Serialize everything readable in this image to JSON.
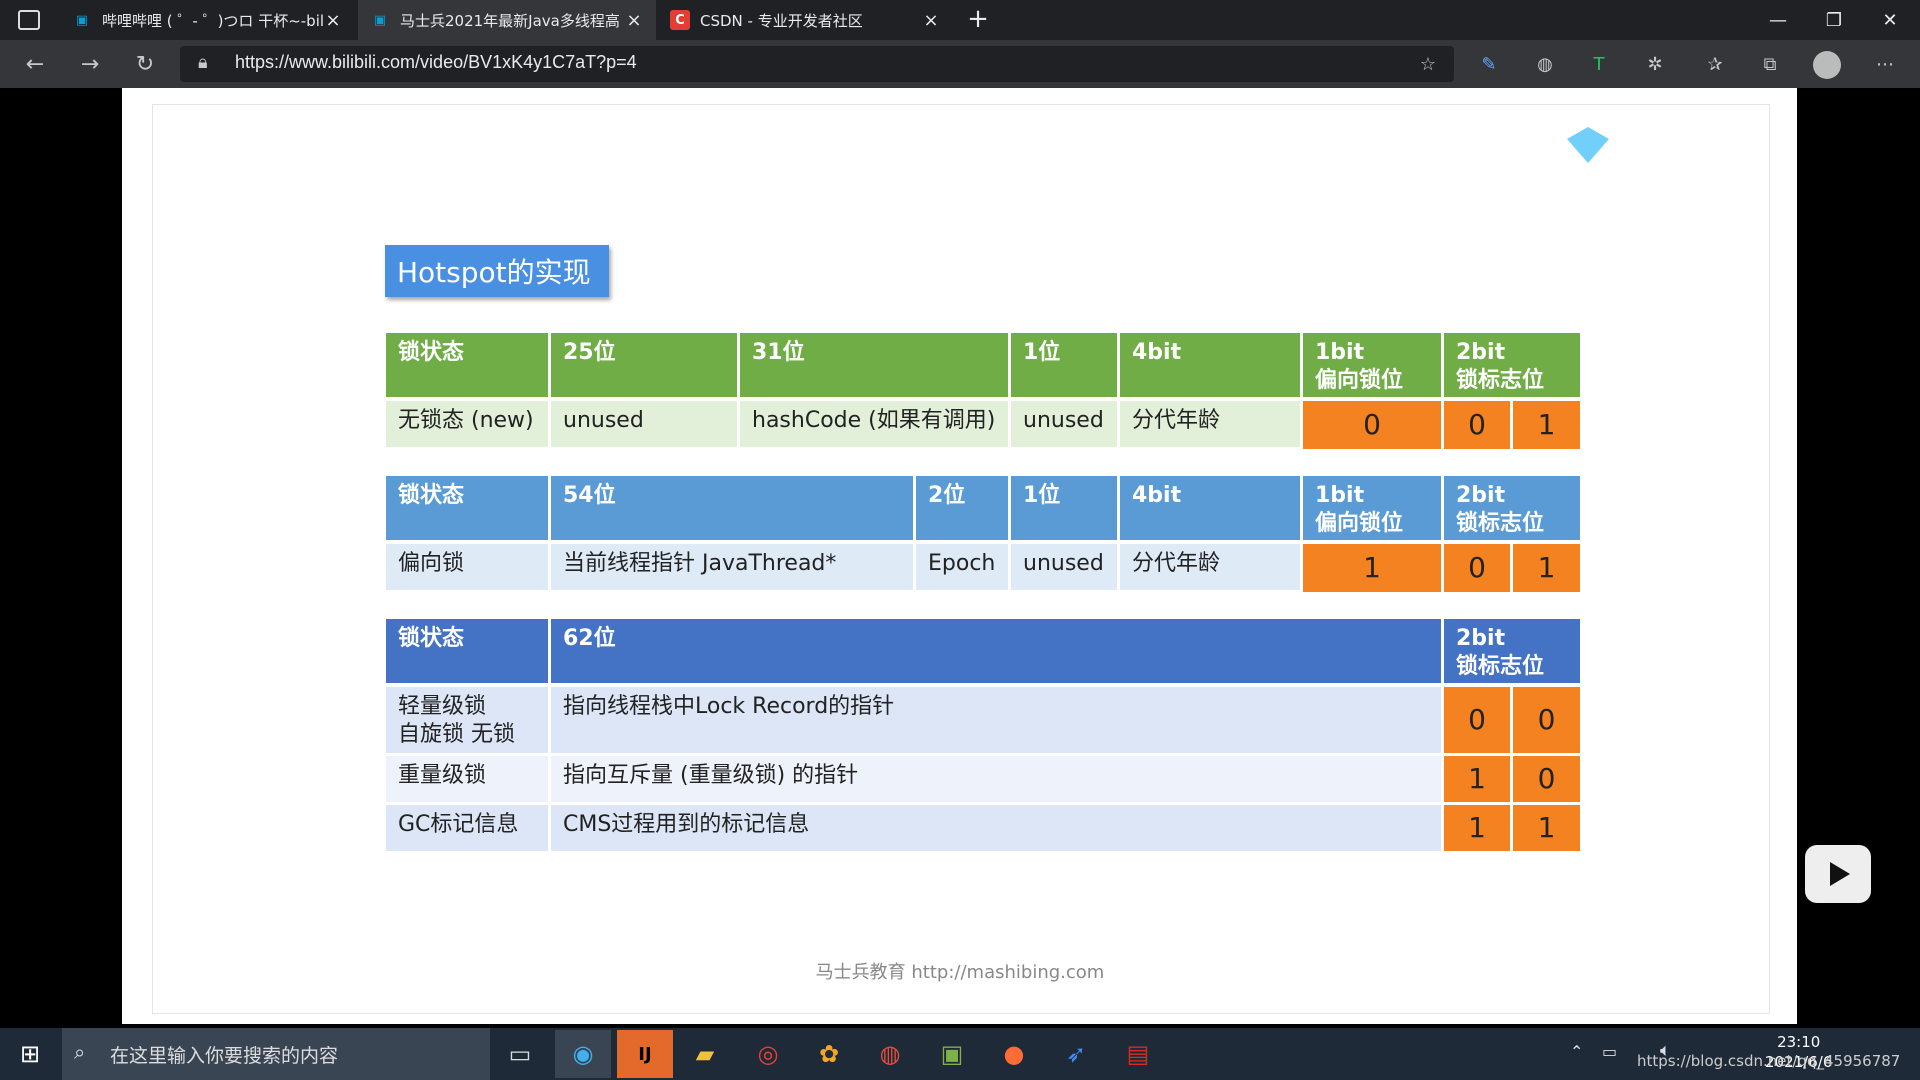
{
  "browser": {
    "tabs": [
      {
        "title": "哔哩哔哩 ( ゜- ゜)つロ 干杯~-bilit"
      },
      {
        "title": "马士兵2021年最新Java多线程高"
      },
      {
        "title": "CSDN - 专业开发者社区"
      }
    ],
    "url": "https://www.bilibili.com/video/BV1xK4y1C7aT?p=4"
  },
  "slide": {
    "title": "Hotspot的实现",
    "table1": {
      "headers": [
        "锁状态",
        "25位",
        "31位",
        "1位",
        "4bit",
        "1bit\n偏向锁位",
        "2bit\n锁标志位"
      ],
      "row": [
        "无锁态 (new)",
        "unused",
        "hashCode (如果有调用)",
        "unused",
        "分代年龄",
        "0",
        "0",
        "1"
      ]
    },
    "table2": {
      "headers": [
        "锁状态",
        "54位",
        "2位",
        "1位",
        "4bit",
        "1bit\n偏向锁位",
        "2bit\n锁标志位"
      ],
      "row": [
        "偏向锁",
        "当前线程指针 JavaThread*",
        "Epoch",
        "unused",
        "分代年龄",
        "1",
        "0",
        "1"
      ]
    },
    "table3": {
      "headers": [
        "锁状态",
        "62位",
        "2bit\n锁标志位"
      ],
      "rows": [
        {
          "state": "轻量级锁\n自旋锁 无锁",
          "desc": "指向线程栈中Lock Record的指针",
          "b1": "0",
          "b2": "0"
        },
        {
          "state": "重量级锁",
          "desc": "指向互斥量 (重量级锁) 的指针",
          "b1": "1",
          "b2": "0"
        },
        {
          "state": "GC标记信息",
          "desc": "CMS过程用到的标记信息",
          "b1": "1",
          "b2": "1"
        }
      ]
    },
    "footer": "马士兵教育 http://mashibing.com"
  },
  "taskbar": {
    "search_placeholder": "在这里输入你要搜索的内容",
    "time": "23:10",
    "date": "2021/6/6",
    "watermark": "https://blog.csdn.net/qq_45956787"
  },
  "colors": {
    "green_header": "#70ad47",
    "blue_header": "#5b9bd5",
    "dark_blue_header": "#4472c4",
    "orange": "#f58220"
  }
}
